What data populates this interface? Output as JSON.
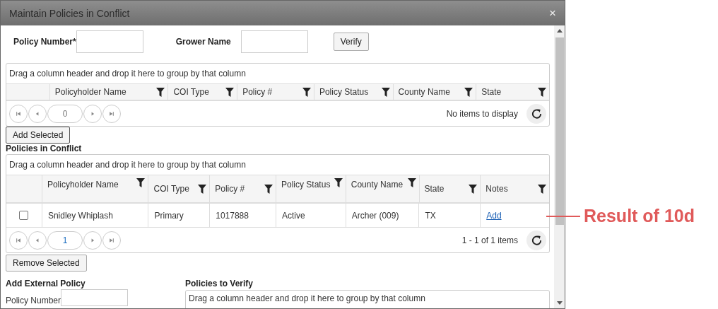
{
  "dialog": {
    "title": "Maintain Policies in Conflict",
    "close": "×"
  },
  "search_form": {
    "fields": [
      {
        "label": "Policy Number*"
      },
      {
        "label": "Grower Name"
      }
    ],
    "verify_button": "Verify"
  },
  "search_grid": {
    "group_hint": "Drag a column header and drop it here to group by that column",
    "columns": [
      "Policyholder Name",
      "COI Type",
      "Policy #",
      "Policy Status",
      "County Name",
      "State"
    ],
    "pager": {
      "page": "0",
      "info": "No items to display"
    }
  },
  "add_button": "Add Selected",
  "conflict_section": {
    "title": "Policies in Conflict",
    "grid": {
      "group_hint": "Drag a column header and drop it here to group by that column",
      "columns": [
        "Policyholder Name",
        "COI Type",
        "Policy #",
        "Policy Status",
        "County Name",
        "State",
        "Notes"
      ],
      "rows": [
        {
          "checked": false,
          "cells": [
            "Snidley Whiplash",
            "Primary",
            "1017888",
            "Active",
            "Archer (009)",
            "TX"
          ],
          "notes_link": "Add"
        }
      ],
      "pager": {
        "page": "1",
        "info": "1 - 1 of 1 items"
      }
    }
  },
  "remove_button": "Remove Selected",
  "external": {
    "title": "Add External Policy",
    "field_label": "Policy Number"
  },
  "verify_section": {
    "title": "Policies to Verify",
    "group_hint": "Drag a column header and drop it here to group by that column"
  },
  "annotation": {
    "text": "Result of 10d"
  }
}
